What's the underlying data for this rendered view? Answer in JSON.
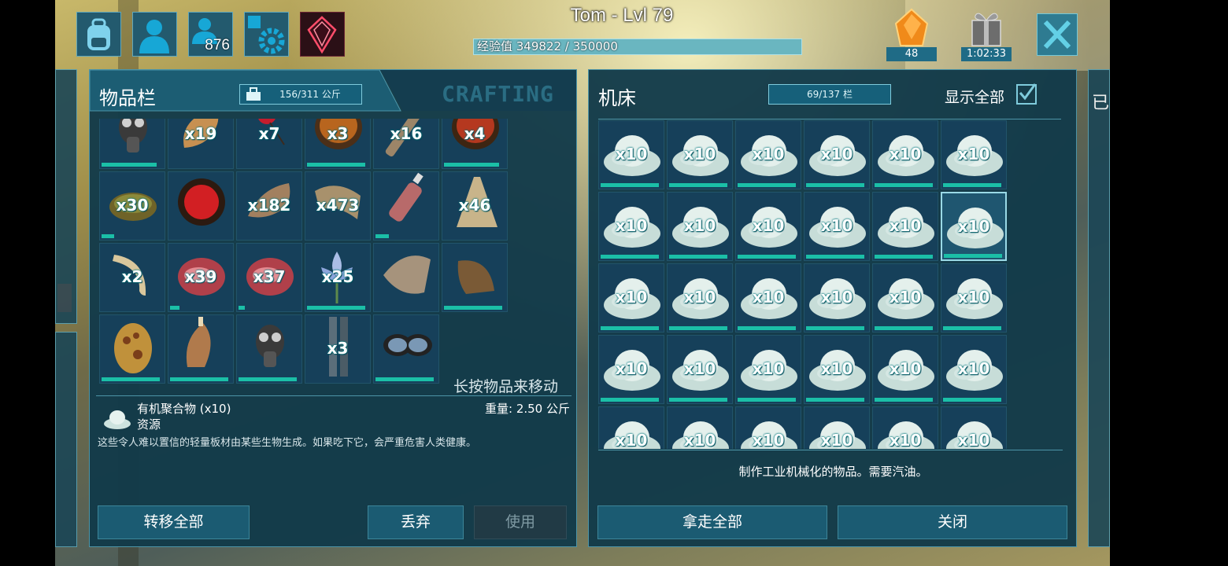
{
  "top_bar": {
    "icons": [
      {
        "name": "backpack-icon"
      },
      {
        "name": "character-icon"
      },
      {
        "name": "tribe-icon",
        "count": "876"
      },
      {
        "name": "settings-icon"
      },
      {
        "name": "element-crystal-icon"
      }
    ],
    "player_label": "Tom - Lvl 79",
    "xp_text": "经验值 349822 / 350000",
    "xp_fraction": 0.99949,
    "amber_count": "48",
    "gift_timer": "1:02:33"
  },
  "inventory": {
    "title": "物品栏",
    "weight_text": "156/311 公斤",
    "tab_crafting": "CRAFTING",
    "hint": "长按物品来移动",
    "items": [
      {
        "icon": "gas-mask-icon",
        "qty": "",
        "bar": 0.9
      },
      {
        "icon": "meat-leg-icon",
        "qty": "x19",
        "bar": 0
      },
      {
        "icon": "berries-icon",
        "qty": "x7",
        "bar": 0
      },
      {
        "icon": "bowl-food-icon",
        "qty": "x3",
        "bar": 0.95
      },
      {
        "icon": "wood-icon",
        "qty": "x16",
        "bar": 0
      },
      {
        "icon": "bowl-soup-icon",
        "qty": "x4",
        "bar": 0.9
      },
      {
        "icon": "dung-icon",
        "qty": "x30",
        "bar": 0.2
      },
      {
        "icon": "bowl-red-icon",
        "qty": "",
        "bar": 0
      },
      {
        "icon": "hide-icon",
        "qty": "x182",
        "bar": 0
      },
      {
        "icon": "fiber-icon",
        "qty": "x473",
        "bar": 0
      },
      {
        "icon": "bottle-icon",
        "qty": "",
        "bar": 0.22
      },
      {
        "icon": "thatch-icon",
        "qty": "x46",
        "bar": 0
      },
      {
        "icon": "tusk-icon",
        "qty": "x2",
        "bar": 0
      },
      {
        "icon": "raw-meat-icon",
        "qty": "x39",
        "bar": 0.15
      },
      {
        "icon": "raw-meat-icon",
        "qty": "x37",
        "bar": 0.1
      },
      {
        "icon": "flower-icon",
        "qty": "x25",
        "bar": 0.95
      },
      {
        "icon": "chitin-icon",
        "qty": "",
        "bar": 0
      },
      {
        "icon": "trophy-icon",
        "qty": "",
        "bar": 0.95
      },
      {
        "icon": "egg-icon",
        "qty": "",
        "bar": 0.95
      },
      {
        "icon": "cooked-meat-icon",
        "qty": "",
        "bar": 0.95
      },
      {
        "icon": "gas-mask-icon",
        "qty": "",
        "bar": 0.95
      },
      {
        "icon": "pipe-icon",
        "qty": "x3",
        "bar": 0
      },
      {
        "icon": "goggles-icon",
        "qty": "",
        "bar": 0.95
      }
    ],
    "selected": {
      "name": "有机聚合物 (x10)",
      "type": "资源",
      "weight": "重量: 2.50 公斤",
      "description": "这些令人难以置信的轻量板材由某些生物生成。如果吃下它，会严重危害人类健康。"
    },
    "buttons": {
      "transfer_all": "转移全部",
      "drop": "丢弃",
      "use": "使用"
    }
  },
  "machine": {
    "title": "机床",
    "slots_text": "69/137 栏",
    "show_all": "显示全部",
    "show_all_checked": true,
    "slot_qty": "x10",
    "slot_count": 30,
    "description": "制作工业机械化的物品。需要汽油。",
    "buttons": {
      "take_all": "拿走全部",
      "close": "关闭"
    }
  },
  "colors": {
    "panel": "#123a4a",
    "accent": "#1bbfa7",
    "qty_glow": "#0a7c80"
  }
}
